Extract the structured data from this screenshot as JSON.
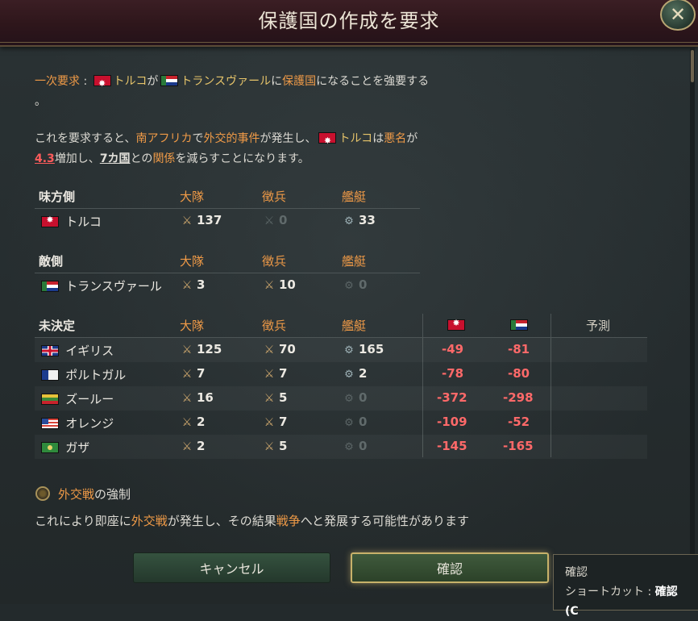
{
  "window": {
    "title": "保護国の作成を要求",
    "close_icon": "close-icon"
  },
  "intro": {
    "label": "一次要求",
    "colon": " : ",
    "actor": "トルコ",
    "ga": "が",
    "target": "トランスヴァール",
    "ni": "に",
    "kw": "保護国",
    "rest": "になることを強要する",
    "line2": "。"
  },
  "consequence": {
    "p1": "これを要求すると、",
    "region": "南アフリカ",
    "de": "で",
    "incident": "外交的事件",
    "p2": "が発生し、",
    "actor": "トルコ",
    "wa": "は",
    "infamy": "悪名",
    "ga": "が",
    "infamy_value": "4.3",
    "p3": "増加し、",
    "countries": "7カ国",
    "to": "との",
    "relations": "関係",
    "p4": "を減らすことになります。"
  },
  "columns": {
    "battalions": "大隊",
    "conscripts": "徴兵",
    "ships": "艦艇",
    "forecast": "予測"
  },
  "allies": {
    "heading": "味方側",
    "rows": [
      {
        "country": "トルコ",
        "flag": "turkey",
        "battalions": "137",
        "conscripts": "0",
        "ships": "33"
      }
    ]
  },
  "enemies": {
    "heading": "敵側",
    "rows": [
      {
        "country": "トランスヴァール",
        "flag": "transvaal",
        "battalions": "3",
        "conscripts": "10",
        "ships": "0"
      }
    ]
  },
  "undecided": {
    "heading": "未決定",
    "rows": [
      {
        "country": "イギリス",
        "flag": "uk",
        "battalions": "125",
        "conscripts": "70",
        "ships": "165",
        "turkey": "-49",
        "transvaal": "-81"
      },
      {
        "country": "ポルトガル",
        "flag": "portugal",
        "battalions": "7",
        "conscripts": "7",
        "ships": "2",
        "turkey": "-78",
        "transvaal": "-80"
      },
      {
        "country": "ズールー",
        "flag": "zulu",
        "battalions": "16",
        "conscripts": "5",
        "ships": "0",
        "turkey": "-372",
        "transvaal": "-298"
      },
      {
        "country": "オレンジ",
        "flag": "orange",
        "battalions": "2",
        "conscripts": "7",
        "ships": "0",
        "turkey": "-109",
        "transvaal": "-52"
      },
      {
        "country": "ガザ",
        "flag": "gaza",
        "battalions": "2",
        "conscripts": "5",
        "ships": "0",
        "turkey": "-145",
        "transvaal": "-165"
      }
    ]
  },
  "force_option": {
    "kw": "外交戦",
    "label_rest": "の強制",
    "desc_a": "これにより即座に",
    "desc_kw1": "外交戦",
    "desc_b": "が発生し、その結果",
    "desc_kw2": "戦争",
    "desc_c": "へと発展する可能性があります"
  },
  "buttons": {
    "cancel": "キャンセル",
    "confirm": "確認"
  },
  "tooltip": {
    "title": "確認",
    "shortcut_label": "ショートカット : ",
    "shortcut_value": "確認 (C"
  },
  "colors": {
    "accent": "#ef9a47",
    "negative": "#ff6969",
    "highlight_gold": "#c8b26a"
  }
}
